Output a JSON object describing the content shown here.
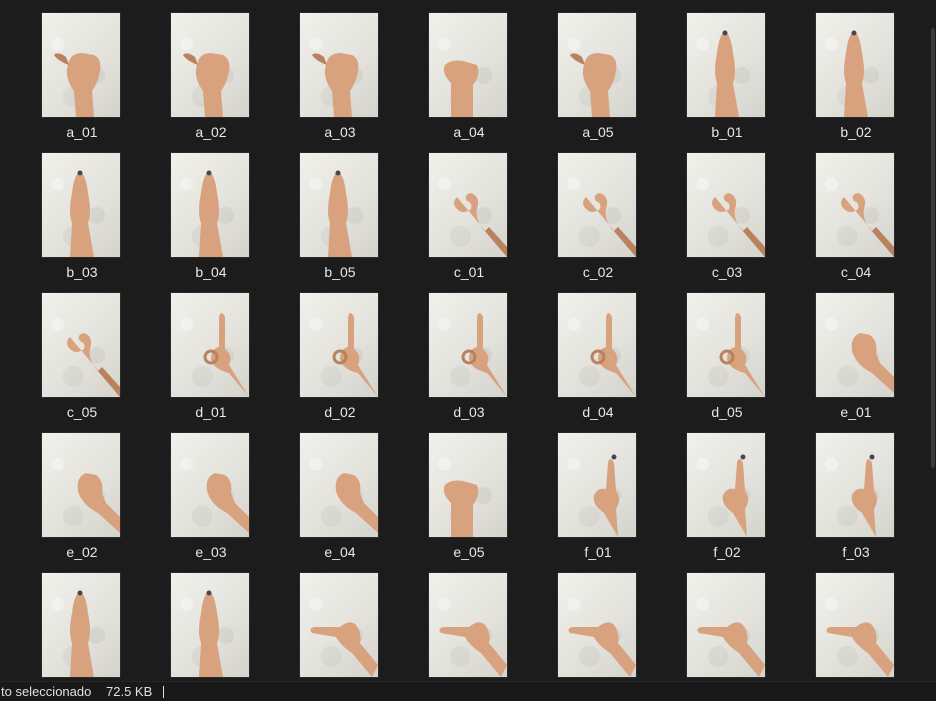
{
  "files": [
    {
      "name": "a_01",
      "pose": "fist-thumb"
    },
    {
      "name": "a_02",
      "pose": "fist-thumb"
    },
    {
      "name": "a_03",
      "pose": "fist-thumb"
    },
    {
      "name": "a_04",
      "pose": "fist"
    },
    {
      "name": "a_05",
      "pose": "fist-thumb"
    },
    {
      "name": "b_01",
      "pose": "flat-up"
    },
    {
      "name": "b_02",
      "pose": "flat-up"
    },
    {
      "name": "b_03",
      "pose": "flat-up"
    },
    {
      "name": "b_04",
      "pose": "flat-up"
    },
    {
      "name": "b_05",
      "pose": "flat-up"
    },
    {
      "name": "c_01",
      "pose": "c-shape"
    },
    {
      "name": "c_02",
      "pose": "c-shape"
    },
    {
      "name": "c_03",
      "pose": "c-shape"
    },
    {
      "name": "c_04",
      "pose": "c-shape"
    },
    {
      "name": "c_05",
      "pose": "c-shape"
    },
    {
      "name": "d_01",
      "pose": "d-shape"
    },
    {
      "name": "d_02",
      "pose": "d-shape"
    },
    {
      "name": "d_03",
      "pose": "d-shape"
    },
    {
      "name": "d_04",
      "pose": "d-shape"
    },
    {
      "name": "d_05",
      "pose": "d-shape"
    },
    {
      "name": "e_01",
      "pose": "claw"
    },
    {
      "name": "e_02",
      "pose": "claw"
    },
    {
      "name": "e_03",
      "pose": "claw"
    },
    {
      "name": "e_04",
      "pose": "claw"
    },
    {
      "name": "e_05",
      "pose": "fist"
    },
    {
      "name": "f_01",
      "pose": "f-shape"
    },
    {
      "name": "f_02",
      "pose": "f-shape"
    },
    {
      "name": "f_03",
      "pose": "f-shape"
    },
    {
      "name": "",
      "pose": "flat-up"
    },
    {
      "name": "",
      "pose": "flat-up"
    },
    {
      "name": "",
      "pose": "point-left"
    },
    {
      "name": "",
      "pose": "point-left"
    },
    {
      "name": "",
      "pose": "point-left"
    },
    {
      "name": "",
      "pose": "point-left"
    },
    {
      "name": "",
      "pose": "point-left"
    }
  ],
  "statusbar": {
    "selection_text": "to seleccionado",
    "size_text": "72.5 KB"
  },
  "colors": {
    "background": "#1c1c1c",
    "skin": "#d9a27f",
    "wall": "#ebeae4"
  }
}
